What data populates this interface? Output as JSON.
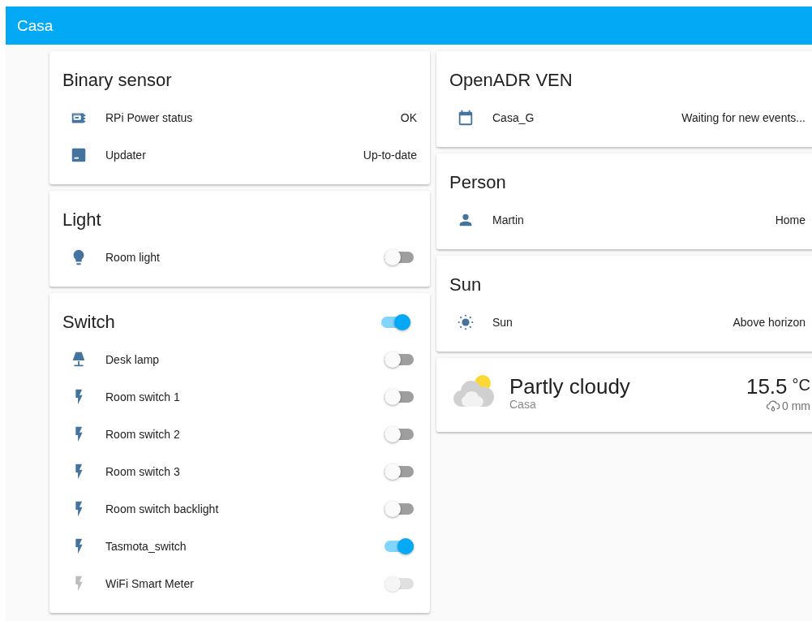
{
  "header": {
    "title": "Casa"
  },
  "columns": [
    [
      {
        "kind": "entities",
        "title": "Binary sensor",
        "rows": [
          {
            "kind": "state",
            "name": "RPi Power status",
            "value": "OK"
          },
          {
            "kind": "state",
            "name": "Updater",
            "value": "Up-to-date"
          }
        ]
      },
      {
        "kind": "entities",
        "title": "Light",
        "rows": [
          {
            "kind": "toggle",
            "name": "Room light",
            "on": false,
            "disabled": false
          }
        ]
      },
      {
        "kind": "entities",
        "title": "Switch",
        "toggle": {
          "on": true
        },
        "rows": [
          {
            "kind": "toggle",
            "name": "Desk lamp",
            "on": false,
            "disabled": false
          },
          {
            "kind": "toggle",
            "name": "Room switch 1",
            "on": false,
            "disabled": false
          },
          {
            "kind": "toggle",
            "name": "Room switch 2",
            "on": false,
            "disabled": false
          },
          {
            "kind": "toggle",
            "name": "Room switch 3",
            "on": false,
            "disabled": false
          },
          {
            "kind": "toggle",
            "name": "Room switch backlight",
            "on": false,
            "disabled": false
          },
          {
            "kind": "toggle",
            "name": "Tasmota_switch",
            "on": true,
            "disabled": false
          },
          {
            "kind": "toggle",
            "name": "WiFi Smart Meter",
            "on": false,
            "disabled": true
          }
        ]
      }
    ],
    [
      {
        "kind": "entities",
        "title": "OpenADR VEN",
        "rows": [
          {
            "kind": "state",
            "name": "Casa_G",
            "value": "Waiting for new events..."
          }
        ]
      },
      {
        "kind": "entities",
        "title": "Person",
        "rows": [
          {
            "kind": "state",
            "name": "Martin",
            "value": "Home"
          }
        ]
      },
      {
        "kind": "entities",
        "title": "Sun",
        "rows": [
          {
            "kind": "state",
            "name": "Sun",
            "value": "Above horizon"
          }
        ]
      },
      {
        "kind": "weather",
        "condition": "Partly cloudy",
        "location": "Casa",
        "temperature": "15.5",
        "unit": "°C",
        "precipitation": "0 mm"
      }
    ]
  ]
}
